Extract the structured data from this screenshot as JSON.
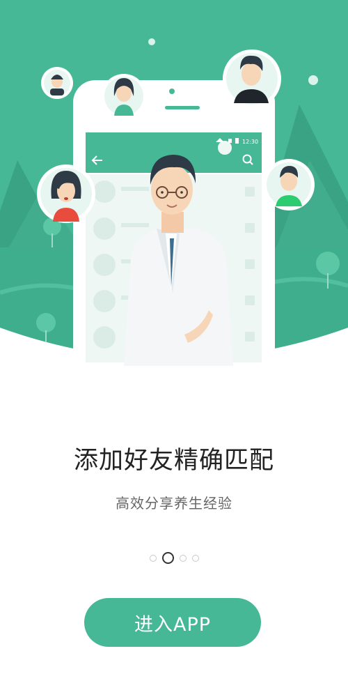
{
  "colors": {
    "primary": "#46b895",
    "primary_dark": "#3aa384",
    "title": "#222222",
    "subtitle": "#666666"
  },
  "phone": {
    "status_time": "12:30"
  },
  "content": {
    "title": "添加好友精确匹配",
    "subtitle": "高效分享养生经验"
  },
  "pager": {
    "count": 4,
    "active_index": 1
  },
  "actions": {
    "enter_label": "进入APP"
  },
  "icons": [
    "back-arrow-icon",
    "search-icon",
    "wifi-icon",
    "signal-icon",
    "battery-icon"
  ]
}
